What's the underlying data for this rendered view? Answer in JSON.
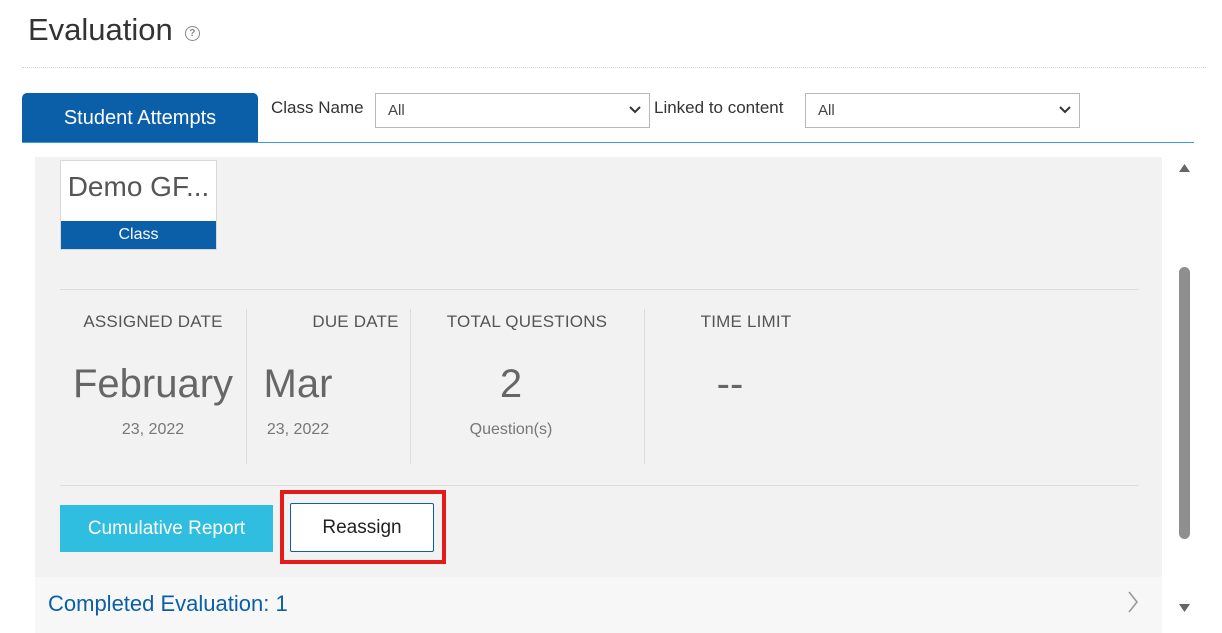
{
  "header": {
    "title": "Evaluation",
    "help_icon": "question-circle-icon"
  },
  "tabs": [
    {
      "label": "Student Attempts",
      "active": true
    }
  ],
  "filters": {
    "class_name": {
      "label": "Class Name",
      "value": "All"
    },
    "linked_content": {
      "label": "Linked to content",
      "value": "All"
    }
  },
  "class_card": {
    "name": "Demo GF...",
    "tag": "Class"
  },
  "stats": {
    "assigned": {
      "label": "ASSIGNED DATE",
      "big": "February",
      "sub": "23, 2022"
    },
    "due": {
      "label": "DUE DATE",
      "big": "Mar",
      "sub": "23, 2022"
    },
    "questions": {
      "label": "TOTAL QUESTIONS",
      "big": "2",
      "sub": "Question(s)"
    },
    "time_limit": {
      "label": "TIME LIMIT",
      "big": "--",
      "sub": ""
    }
  },
  "actions": {
    "cumulative_report": "Cumulative Report",
    "reassign": "Reassign"
  },
  "completed": {
    "label": "Completed Evaluation: 1"
  },
  "colors": {
    "primary_blue": "#0b5ea8",
    "cyan_button": "#2fbee0",
    "highlight_red": "#e41b1b"
  }
}
